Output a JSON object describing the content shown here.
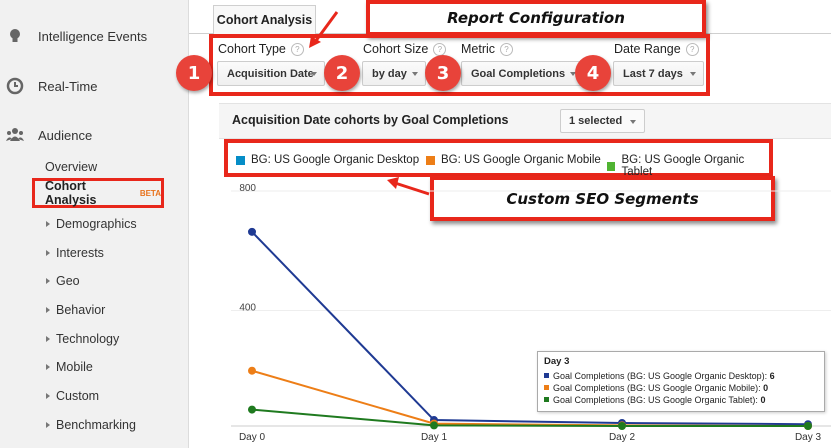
{
  "sidebar": {
    "sections": [
      {
        "label": "Intelligence Events",
        "icon": "lightbulb-icon"
      },
      {
        "label": "Real-Time",
        "icon": "clock-icon"
      },
      {
        "label": "Audience",
        "icon": "people-icon"
      }
    ],
    "overview": "Overview",
    "cohort": {
      "label": "Cohort Analysis",
      "badge": "BETA"
    },
    "items": [
      "Demographics",
      "Interests",
      "Geo",
      "Behavior",
      "Technology",
      "Mobile",
      "Custom",
      "Benchmarking"
    ]
  },
  "tab": {
    "label": "Cohort Analysis"
  },
  "callouts": {
    "report": "Report Configuration",
    "seo": "Custom SEO Segments"
  },
  "config": {
    "cohort_type": {
      "label": "Cohort Type",
      "value": "Acquisition Date"
    },
    "cohort_size": {
      "label": "Cohort Size",
      "value": "by day"
    },
    "metric": {
      "label": "Metric",
      "value": "Goal Completions"
    },
    "date_range": {
      "label": "Date Range",
      "value": "Last 7 days"
    }
  },
  "badges": [
    "1",
    "2",
    "3",
    "4"
  ],
  "chart_header": {
    "title": "Acquisition Date cohorts by Goal Completions",
    "selected": "1 selected"
  },
  "legend": [
    {
      "name": "BG: US Google Organic Desktop",
      "color": "#058dc7"
    },
    {
      "name": "BG: US Google Organic Mobile",
      "color": "#ed7e17"
    },
    {
      "name": "BG: US Google Organic Tablet",
      "color": "#50b432"
    }
  ],
  "tooltip": {
    "title": "Day 3",
    "rows": [
      {
        "label": "Goal Completions (BG: US Google Organic Desktop):",
        "value": "6",
        "color": "#1f3a93"
      },
      {
        "label": "Goal Completions (BG: US Google Organic Mobile):",
        "value": "0",
        "color": "#ed7e17"
      },
      {
        "label": "Goal Completions (BG: US Google Organic Tablet):",
        "value": "0",
        "color": "#1f7a1f"
      }
    ]
  },
  "chart_data": {
    "type": "line",
    "categories": [
      "Day 0",
      "Day 1",
      "Day 2",
      "Day 3"
    ],
    "y_ticks": [
      "800",
      "400"
    ],
    "ylim": [
      0,
      800
    ],
    "series": [
      {
        "name": "BG: US Google Organic Desktop",
        "values": [
          650,
          20,
          10,
          6
        ],
        "color": "#1f3a93"
      },
      {
        "name": "BG: US Google Organic Mobile",
        "values": [
          185,
          8,
          2,
          0
        ],
        "color": "#ed7e17"
      },
      {
        "name": "BG: US Google Organic Tablet",
        "values": [
          55,
          2,
          0,
          0
        ],
        "color": "#1f7a1f"
      }
    ]
  }
}
